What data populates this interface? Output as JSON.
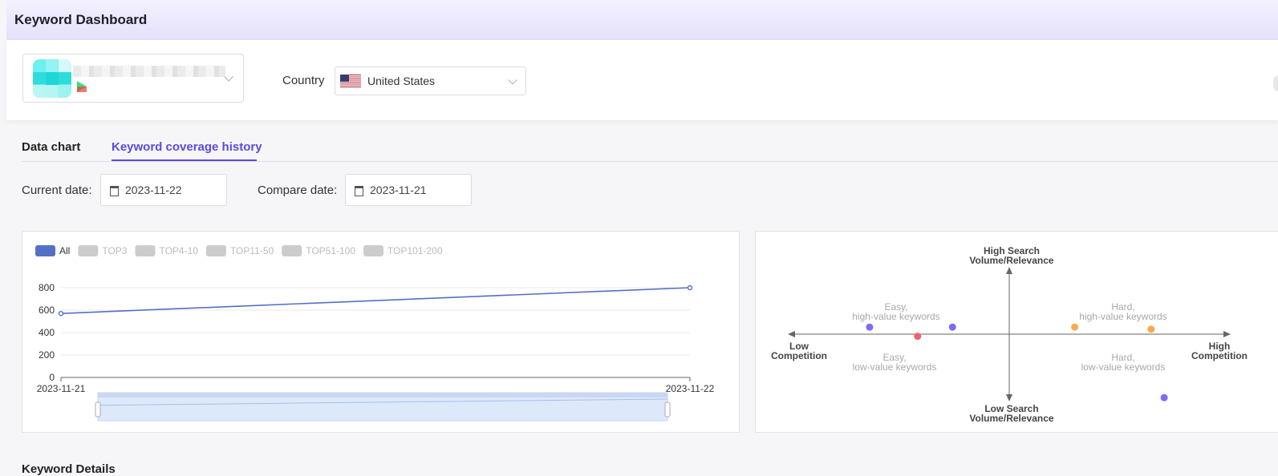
{
  "header": {
    "title": "Keyword Dashboard"
  },
  "app_selector": {
    "icon": "app-icon-blurred",
    "store_icon": "google-play-icon",
    "chevron": "chevron-down-icon"
  },
  "country": {
    "label": "Country",
    "value": "United States",
    "flag_icon": "us-flag-icon"
  },
  "tabs": [
    {
      "label": "Data chart",
      "active": false
    },
    {
      "label": "Keyword coverage history",
      "active": true
    }
  ],
  "dates": {
    "current_label": "Current date:",
    "current_value": "2023-11-22",
    "compare_label": "Compare date:",
    "compare_value": "2023-11-21",
    "icon": "calendar-icon"
  },
  "chart_data": [
    {
      "type": "line",
      "legend": [
        {
          "name": "All",
          "active": true,
          "color": "#5470c6"
        },
        {
          "name": "TOP3",
          "active": false
        },
        {
          "name": "TOP4-10",
          "active": false
        },
        {
          "name": "TOP11-50",
          "active": false
        },
        {
          "name": "TOP51-100",
          "active": false
        },
        {
          "name": "TOP101-200",
          "active": false
        }
      ],
      "legend_position": "top-left",
      "categories": [
        "2023-11-21",
        "2023-11-22"
      ],
      "series": [
        {
          "name": "All",
          "values": [
            570,
            800
          ]
        }
      ],
      "yticks": [
        0,
        200,
        400,
        600,
        800
      ],
      "ylim": [
        0,
        800
      ],
      "grid": true,
      "data_zoom": true,
      "line_color": "#5470c6"
    },
    {
      "type": "scatter",
      "axis_labels": {
        "top": [
          "High Search",
          "Volume/Relevance"
        ],
        "bottom": [
          "Low Search",
          "Volume/Relevance"
        ],
        "left": [
          "Low",
          "Competition"
        ],
        "right": [
          "High",
          "Competition"
        ]
      },
      "quadrant_labels": {
        "top_left": [
          "Easy,",
          "high-value keywords"
        ],
        "top_right": [
          "Hard,",
          "high-value keywords"
        ],
        "bottom_left": [
          "Easy,",
          "low-value keywords"
        ],
        "bottom_right": [
          "Hard,",
          "low-value keywords"
        ]
      },
      "xlim": [
        -1,
        1
      ],
      "ylim": [
        -1,
        1
      ],
      "points": [
        {
          "x": -0.64,
          "y": 0.1,
          "color": "#7b6cf6"
        },
        {
          "x": -0.42,
          "y": -0.03,
          "color": "#f2636e"
        },
        {
          "x": -0.26,
          "y": 0.1,
          "color": "#7b6cf6"
        },
        {
          "x": 0.3,
          "y": 0.1,
          "color": "#f8a94f"
        },
        {
          "x": 0.65,
          "y": 0.07,
          "color": "#f8a94f"
        },
        {
          "x": 0.71,
          "y": -0.9,
          "color": "#7b6cf6"
        }
      ]
    }
  ],
  "section_next": {
    "title": "Keyword Details"
  }
}
